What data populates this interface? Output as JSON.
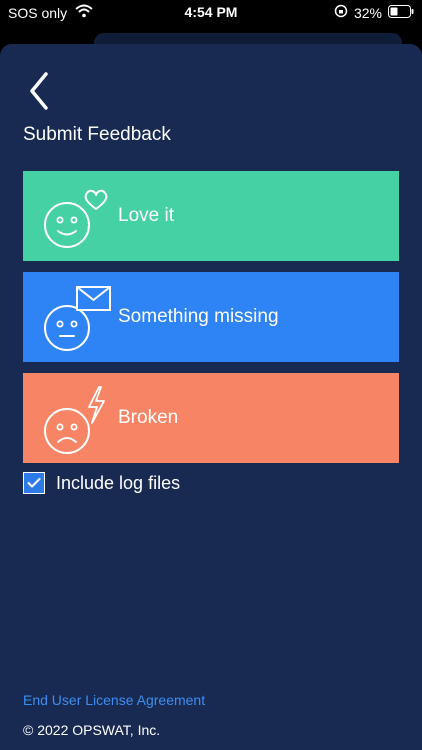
{
  "status_bar": {
    "carrier": "SOS only",
    "time": "4:54 PM",
    "battery": "32%"
  },
  "header": {
    "title": "Submit Feedback",
    "back_icon": "chevron-left-icon"
  },
  "options": [
    {
      "label": "Love it",
      "icon": "smile-heart-icon",
      "color": "#45d1a4"
    },
    {
      "label": "Something missing",
      "icon": "neutral-mail-icon",
      "color": "#2f84f5"
    },
    {
      "label": "Broken",
      "icon": "sad-lightning-icon",
      "color": "#f78565"
    }
  ],
  "log_files": {
    "label": "Include log files",
    "checked": true
  },
  "footer": {
    "eula": "End User License Agreement",
    "copyright": "© 2022 OPSWAT, Inc."
  },
  "colors": {
    "background": "#182a52",
    "accent": "#3d8ef2"
  }
}
